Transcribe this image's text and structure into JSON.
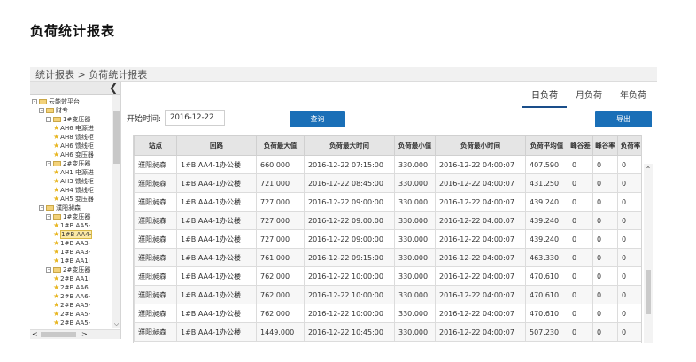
{
  "page_title": "负荷统计报表",
  "breadcrumb": "统计报表 > 负荷统计报表",
  "sidebar": {
    "collapse_glyph": "❮",
    "tree": [
      {
        "level": 0,
        "toggle": "⊟",
        "type": "folder",
        "label": "云能效平台"
      },
      {
        "level": 1,
        "toggle": "⊟",
        "type": "folder",
        "label": "财专"
      },
      {
        "level": 2,
        "toggle": "⊟",
        "type": "folder",
        "label": "1#变压器"
      },
      {
        "level": 3,
        "type": "leaf",
        "label": "AH6 电源进"
      },
      {
        "level": 3,
        "type": "leaf",
        "label": "AH8 馈线柜"
      },
      {
        "level": 3,
        "type": "leaf",
        "label": "AH6 馈线柜"
      },
      {
        "level": 3,
        "type": "leaf",
        "label": "AH6 变压器"
      },
      {
        "level": 2,
        "toggle": "⊟",
        "type": "folder",
        "label": "2#变压器"
      },
      {
        "level": 3,
        "type": "leaf",
        "label": "AH1 电源进"
      },
      {
        "level": 3,
        "type": "leaf",
        "label": "AH3 馈线柜"
      },
      {
        "level": 3,
        "type": "leaf",
        "label": "AH4 馈线柜"
      },
      {
        "level": 3,
        "type": "leaf",
        "label": "AH5 变压器"
      },
      {
        "level": 1,
        "toggle": "⊟",
        "type": "folder",
        "label": "濮阳昶森"
      },
      {
        "level": 2,
        "toggle": "⊟",
        "type": "folder",
        "label": "1#变压器"
      },
      {
        "level": 3,
        "type": "leaf",
        "label": "1#B AA5-"
      },
      {
        "level": 3,
        "type": "leaf",
        "label": "1#B AA4-",
        "selected": true
      },
      {
        "level": 3,
        "type": "leaf",
        "label": "1#B AA3-"
      },
      {
        "level": 3,
        "type": "leaf",
        "label": "1#B AA3-"
      },
      {
        "level": 3,
        "type": "leaf",
        "label": "1#B AA1i"
      },
      {
        "level": 2,
        "toggle": "⊟",
        "type": "folder",
        "label": "2#变压器"
      },
      {
        "level": 3,
        "type": "leaf",
        "label": "2#B AA1i"
      },
      {
        "level": 3,
        "type": "leaf",
        "label": "2#B AA6"
      },
      {
        "level": 3,
        "type": "leaf",
        "label": "2#B AA6-"
      },
      {
        "level": 3,
        "type": "leaf",
        "label": "2#B AA5-"
      },
      {
        "level": 3,
        "type": "leaf",
        "label": "2#B AA5-"
      },
      {
        "level": 3,
        "type": "leaf",
        "label": "2#B AA5-"
      }
    ]
  },
  "tabs": [
    {
      "label": "日负荷",
      "active": true
    },
    {
      "label": "月负荷",
      "active": false
    },
    {
      "label": "年负荷",
      "active": false
    }
  ],
  "filter": {
    "start_label": "开始时间:",
    "start_value": "2016-12-22",
    "query_label": "查询",
    "export_label": "导出"
  },
  "table": {
    "columns": [
      "站点",
      "回路",
      "负荷最大值",
      "负荷最大时间",
      "负荷最小值",
      "负荷最小时间",
      "负荷平均值",
      "峰谷差",
      "峰谷率",
      "负荷率"
    ],
    "rows": [
      [
        "濮阳昶森",
        "1#B AA4-1办公楼",
        "660.000",
        "2016-12-22 07:15:00",
        "330.000",
        "2016-12-22 04:00:07",
        "407.590",
        "0",
        "0",
        "0"
      ],
      [
        "濮阳昶森",
        "1#B AA4-1办公楼",
        "721.000",
        "2016-12-22 08:45:00",
        "330.000",
        "2016-12-22 04:00:07",
        "431.250",
        "0",
        "0",
        "0"
      ],
      [
        "濮阳昶森",
        "1#B AA4-1办公楼",
        "727.000",
        "2016-12-22 09:00:00",
        "330.000",
        "2016-12-22 04:00:07",
        "439.240",
        "0",
        "0",
        "0"
      ],
      [
        "濮阳昶森",
        "1#B AA4-1办公楼",
        "727.000",
        "2016-12-22 09:00:00",
        "330.000",
        "2016-12-22 04:00:07",
        "439.240",
        "0",
        "0",
        "0"
      ],
      [
        "濮阳昶森",
        "1#B AA4-1办公楼",
        "727.000",
        "2016-12-22 09:00:00",
        "330.000",
        "2016-12-22 04:00:07",
        "439.240",
        "0",
        "0",
        "0"
      ],
      [
        "濮阳昶森",
        "1#B AA4-1办公楼",
        "761.000",
        "2016-12-22 09:15:00",
        "330.000",
        "2016-12-22 04:00:07",
        "463.330",
        "0",
        "0",
        "0"
      ],
      [
        "濮阳昶森",
        "1#B AA4-1办公楼",
        "762.000",
        "2016-12-22 10:00:00",
        "330.000",
        "2016-12-22 04:00:07",
        "470.610",
        "0",
        "0",
        "0"
      ],
      [
        "濮阳昶森",
        "1#B AA4-1办公楼",
        "762.000",
        "2016-12-22 10:00:00",
        "330.000",
        "2016-12-22 04:00:07",
        "470.610",
        "0",
        "0",
        "0"
      ],
      [
        "濮阳昶森",
        "1#B AA4-1办公楼",
        "762.000",
        "2016-12-22 10:00:00",
        "330.000",
        "2016-12-22 04:00:07",
        "470.610",
        "0",
        "0",
        "0"
      ],
      [
        "濮阳昶森",
        "1#B AA4-1办公楼",
        "1449.000",
        "2016-12-22 10:45:00",
        "330.000",
        "2016-12-22 04:00:07",
        "507.230",
        "0",
        "0",
        "0"
      ]
    ]
  }
}
